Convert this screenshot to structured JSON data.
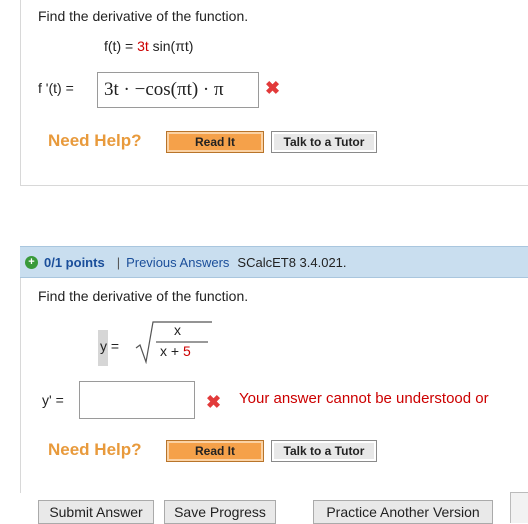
{
  "q1": {
    "prompt": "Find the derivative of the function.",
    "function_lhs": "f(t)",
    "function_eq": "=",
    "function_coef": "3t",
    "function_rest": " sin(πt)",
    "answer_label": "f '(t)",
    "answer_eq": "=",
    "answer_value": "3t · −cos(πt) · π",
    "status_icon": "x-mark-icon",
    "need_help": "Need Help?",
    "read_it": "Read It",
    "talk_tutor": "Talk to a Tutor"
  },
  "q2_header": {
    "points": "0/1 points",
    "separator": "|",
    "previous_answers": "Previous Answers",
    "code": "SCalcET8 3.4.021."
  },
  "q2": {
    "prompt": "Find the derivative of the function.",
    "y": "y",
    "eq": "=",
    "numerator": "x",
    "denominator_var": "x",
    "denominator_plus": "+",
    "denominator_const": "5",
    "answer_label": "y'",
    "answer_eq": "=",
    "answer_value": "",
    "error_message": "Your answer cannot be understood or",
    "need_help": "Need Help?",
    "read_it": "Read It",
    "talk_tutor": "Talk to a Tutor"
  },
  "footer": {
    "submit": "Submit Answer",
    "save": "Save Progress",
    "practice": "Practice Another Version"
  },
  "colors": {
    "accent_orange": "#f5a14a",
    "need_help": "#e89a3c",
    "error_red": "#cc0000",
    "header_blue": "#c9deef",
    "link_blue": "#1a4e9a"
  }
}
